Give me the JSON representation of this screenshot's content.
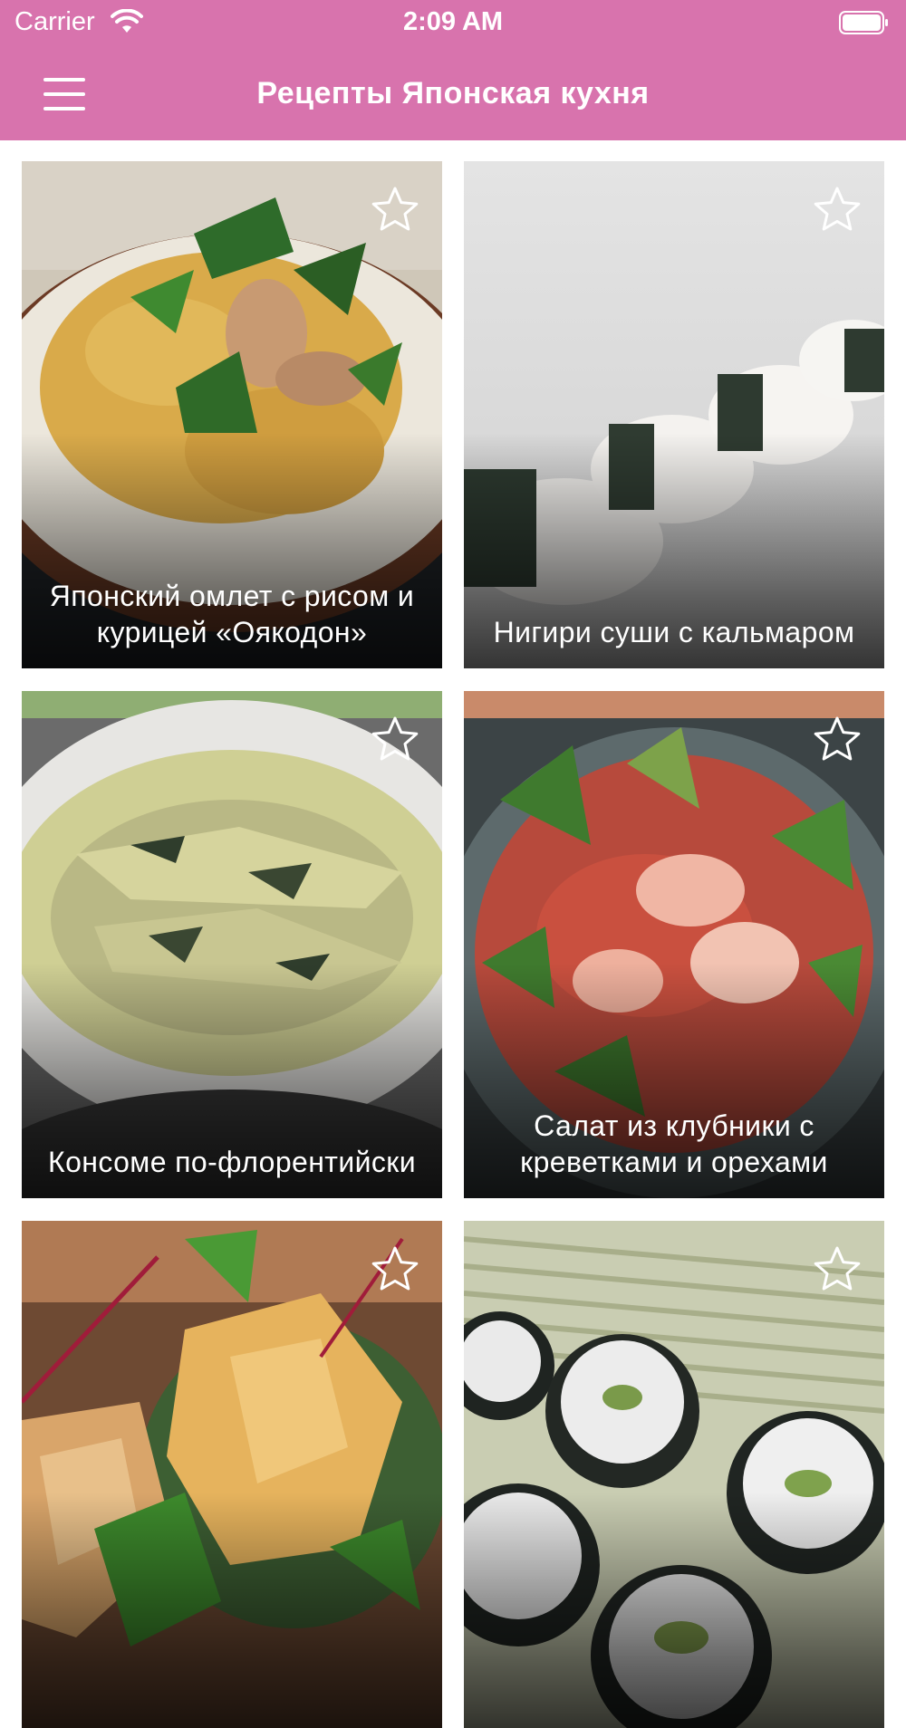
{
  "status_bar": {
    "carrier": "Carrier",
    "time": "2:09 AM"
  },
  "header": {
    "title": "Рецепты Японская кухня",
    "menu_icon": "hamburger-menu-icon"
  },
  "accent_color": "#d873ad",
  "recipes": [
    {
      "title": "Японский омлет с рисом и курицей «Оякодон»",
      "favorite_icon": "star-outline-icon"
    },
    {
      "title": "Нигири суши с кальмаром",
      "favorite_icon": "star-outline-icon"
    },
    {
      "title": "Консоме по-флорентийски",
      "favorite_icon": "star-outline-icon"
    },
    {
      "title": "Салат из клубники с креветками и орехами",
      "favorite_icon": "star-outline-icon"
    },
    {
      "title": "",
      "favorite_icon": "star-outline-icon"
    },
    {
      "title": "",
      "favorite_icon": "star-outline-icon"
    }
  ]
}
